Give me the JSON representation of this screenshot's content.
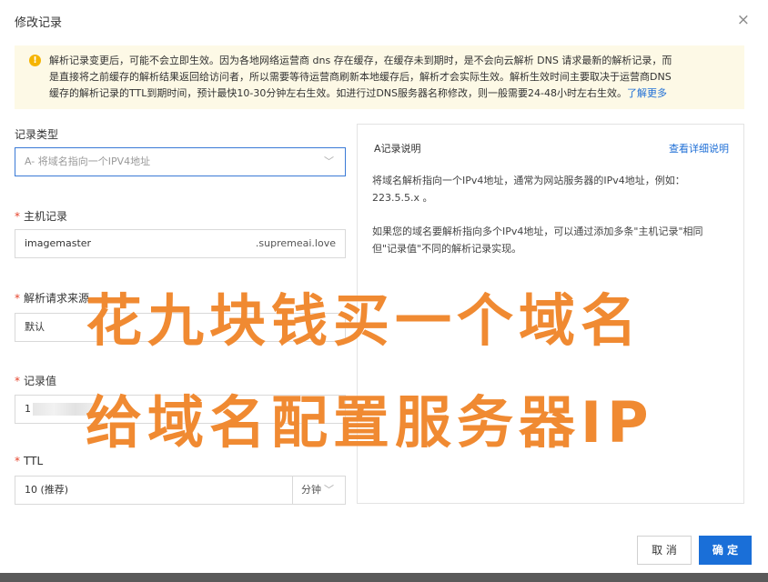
{
  "dialog": {
    "title": "修改记录",
    "close_glyph": "×"
  },
  "notice": {
    "icon": "warning-icon",
    "icon_glyph": "!",
    "line1": "解析记录变更后，可能不会立即生效。因为各地网络运营商 dns 存在缓存，在缓存未到期时，是不会向云解析 DNS 请求最新的解析记录，而",
    "line2": "是直接将之前缓存的解析结果返回给访问者，所以需要等待运营商刷新本地缓存后，解析才会实际生效。解析生效时间主要取决于运营商DNS",
    "line3": "缓存的解析记录的TTL到期时间，预计最快10-30分钟左右生效。如进行过DNS服务器名称修改，则一般需要24-48小时左右生效。",
    "link": "了解更多"
  },
  "form": {
    "record_type": {
      "label": "记录类型",
      "value": "A- 将域名指向一个IPV4地址",
      "chevron": "﹀"
    },
    "host_record": {
      "required_mark": "*",
      "label": "主机记录",
      "value": "imagemaster",
      "suffix": ".supremeai.love"
    },
    "resolve_source": {
      "required_mark": "*",
      "label": "解析请求来源",
      "value": "默认"
    },
    "record_value": {
      "required_mark": "*",
      "label": "记录值",
      "value": "1"
    },
    "ttl": {
      "required_mark": "*",
      "label": "TTL",
      "value": "10 (推荐)",
      "unit": "分钟",
      "chevron": "﹀"
    }
  },
  "info_panel": {
    "title": "A记录说明",
    "link": "查看详细说明",
    "para1_line1": "将域名解析指向一个IPv4地址，通常为网站服务器的IPv4地址，例如：",
    "para1_line2": "223.5.5.x 。",
    "para2_line1": "如果您的域名要解析指向多个IPv4地址，可以通过添加多条\"主机记录\"相同",
    "para2_line2": "但\"记录值\"不同的解析记录实现。"
  },
  "overlay": {
    "line1": "花九块钱买一个域名",
    "line2": "给域名配置服务器IP",
    "color": "#f08a32"
  },
  "footer": {
    "cancel_label": "取 消",
    "ok_label": "确 定"
  },
  "colors": {
    "primary": "#1a6fd8",
    "link": "#1f6fd6",
    "required": "#e5432b",
    "notice_bg": "#fdf9e6",
    "warning": "#f5b400"
  }
}
